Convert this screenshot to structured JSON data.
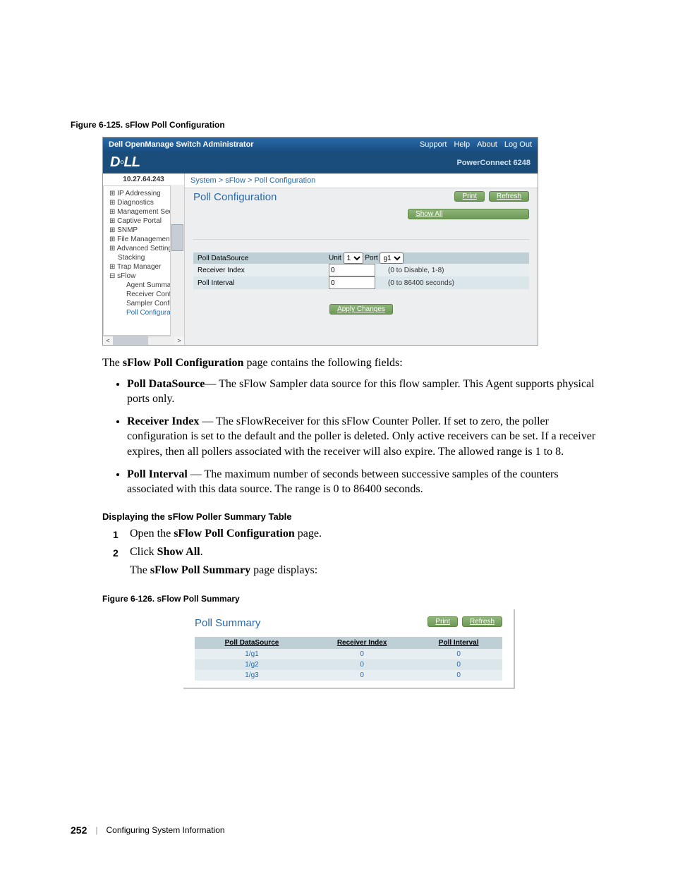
{
  "figure1": {
    "caption": "Figure 6-125.    sFlow Poll Configuration"
  },
  "ss1": {
    "appTitle": "Dell OpenManage Switch Administrator",
    "topLinks": {
      "support": "Support",
      "help": "Help",
      "about": "About",
      "logout": "Log Out"
    },
    "brandRight": "PowerConnect 6248",
    "ip": "10.27.64.243",
    "breadcrumb": "System > sFlow > Poll Configuration",
    "sidebar": {
      "items": [
        "IP Addressing",
        "Diagnostics",
        "Management Secur",
        "Captive Portal",
        "SNMP",
        "File Management",
        "Advanced Settings",
        "Stacking",
        "Trap Manager",
        "sFlow"
      ],
      "sflowChildren": [
        "Agent Summary",
        "Receiver Configu",
        "Sampler Configu",
        "Poll Configuration"
      ]
    },
    "panel": {
      "title": "Poll Configuration",
      "buttons": {
        "print": "Print",
        "refresh": "Refresh",
        "showAll": "Show All"
      },
      "rows": {
        "ds": {
          "label": "Poll DataSource",
          "unitLabel": "Unit",
          "unitVal": "1",
          "portLabel": "Port",
          "portVal": "g1"
        },
        "rx": {
          "label": "Receiver Index",
          "value": "0",
          "hint": "(0 to Disable, 1-8)"
        },
        "pi": {
          "label": "Poll Interval",
          "value": "0",
          "hint": "(0 to 86400 seconds)"
        }
      },
      "apply": "Apply Changes"
    }
  },
  "intro": "The sFlow Poll Configuration page contains the following fields:",
  "bullets": {
    "b1_term": "Poll DataSource",
    "b1_text": "— The sFlow Sampler data source for this flow sampler. This Agent supports physical ports only.",
    "b2_term": "Receiver Index ",
    "b2_text": "— The sFlowReceiver for this sFlow Counter Poller. If set to zero, the poller configuration is set to the default and the poller is deleted. Only active receivers can be set. If a receiver expires, then all pollers associated with the receiver will also expire. The allowed range is 1 to 8.",
    "b3_term": "Poll Interval ",
    "b3_text": "— The maximum number of seconds between successive samples of the counters associated with this data source. The range is 0 to 86400 seconds."
  },
  "section2": {
    "head": "Displaying the sFlow Poller Summary Table",
    "step1_pre": "Open the ",
    "step1_bold": "sFlow Poll Configuration",
    "step1_post": " page.",
    "step2_pre": "Click ",
    "step2_bold": "Show All",
    "step2_post": ".",
    "sub_pre": "The ",
    "sub_bold": "sFlow Poll Summary",
    "sub_post": " page displays:"
  },
  "figure2": {
    "caption": "Figure 6-126.    sFlow Poll Summary"
  },
  "ss2": {
    "title": "Poll Summary",
    "buttons": {
      "print": "Print",
      "refresh": "Refresh"
    },
    "headers": {
      "ds": "Poll DataSource",
      "rx": "Receiver Index",
      "pi": "Poll Interval"
    }
  },
  "chart_data": {
    "type": "table",
    "title": "Poll Summary",
    "columns": [
      "Poll DataSource",
      "Receiver Index",
      "Poll Interval"
    ],
    "rows": [
      {
        "ds": "1/g1",
        "rx": "0",
        "pi": "0"
      },
      {
        "ds": "1/g2",
        "rx": "0",
        "pi": "0"
      },
      {
        "ds": "1/g3",
        "rx": "0",
        "pi": "0"
      }
    ]
  },
  "footer": {
    "page": "252",
    "chapter": "Configuring System Information"
  }
}
